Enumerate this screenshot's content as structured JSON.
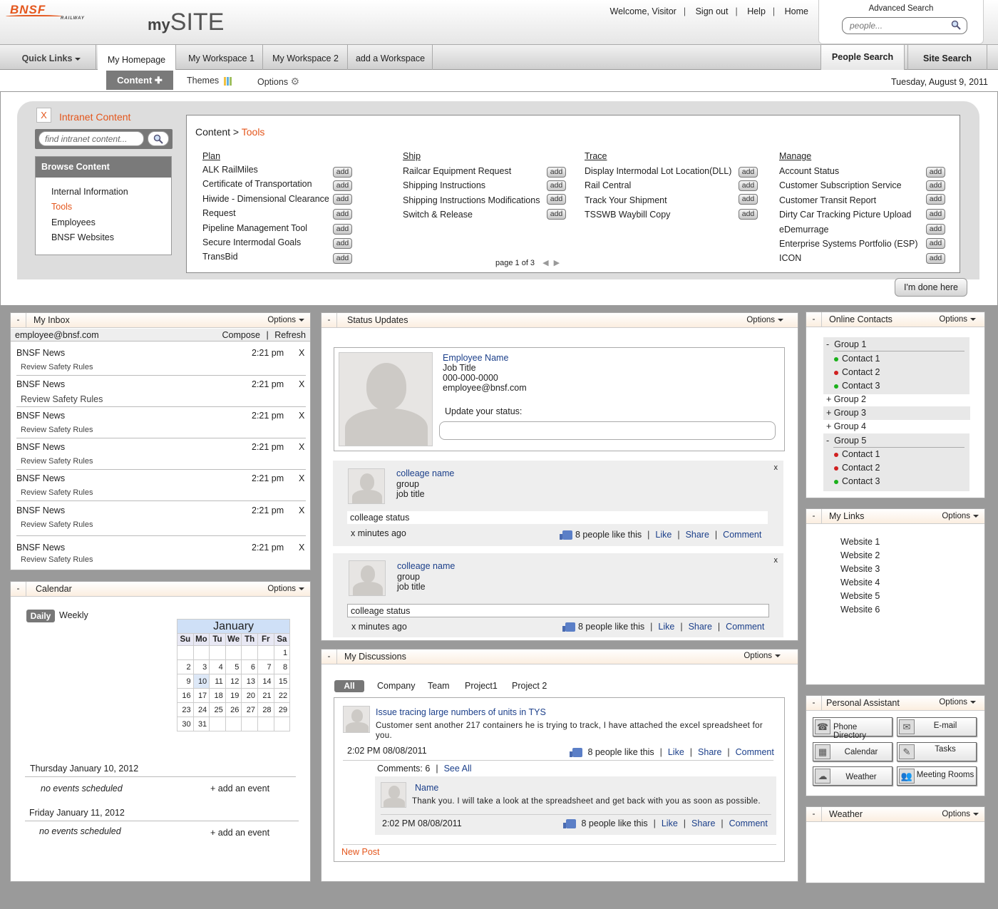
{
  "header": {
    "logo_text": "BNSF",
    "logo_sub": "RAILWAY",
    "site_prefix": "my",
    "site_title": "SITE",
    "links": [
      "Welcome, Visitor",
      "Sign out",
      "Help",
      "Home"
    ],
    "advanced_search": "Advanced Search",
    "people_placeholder": "people..."
  },
  "nav": {
    "quick_links": "Quick Links",
    "tabs": [
      "My Homepage",
      "My Workspace 1",
      "My Workspace 2",
      "add a Workspace"
    ],
    "people_search": "People Search",
    "site_search": "Site Search"
  },
  "subnav": {
    "content": "Content",
    "themes": "Themes",
    "options": "Options",
    "date": "Tuesday, August 9, 2011"
  },
  "intranet": {
    "close": "X",
    "title": "Intranet Content",
    "search_placeholder": "find intranet content...",
    "browse_title": "Browse Content",
    "browse_items": [
      "Internal Information",
      "Tools",
      "Employees",
      "BNSF Websites"
    ],
    "crumb_root": "Content >",
    "crumb_current": "Tools",
    "add_label": "add",
    "page": "page 1 of 3",
    "done": "I'm done here",
    "columns": [
      {
        "title": "Plan",
        "items": [
          "ALK RailMiles",
          "Certificate of Transportation",
          "Hiwide - Dimensional Clearance",
          "Request",
          "Pipeline Management Tool",
          "Secure Intermodal Goals",
          "TransBid"
        ]
      },
      {
        "title": "Ship",
        "items": [
          "Railcar Equipment Request",
          "Shipping Instructions",
          "Shipping Instructions Modifications",
          "Switch & Release"
        ]
      },
      {
        "title": "Trace",
        "items": [
          "Display Intermodal Lot Location(DLL)",
          "Rail Central",
          "Track Your Shipment",
          "TSSWB Waybill Copy"
        ]
      },
      {
        "title": "Manage",
        "items": [
          "Account Status",
          "Customer Subscription Service",
          "Customer Transit Report",
          "Dirty Car Tracking Picture Upload",
          "eDemurrage",
          "Enterprise Systems Portfolio (ESP)",
          "ICON"
        ]
      }
    ]
  },
  "inbox": {
    "title": "My Inbox",
    "options": "Options",
    "email": "employee@bnsf.com",
    "compose": "Compose",
    "refresh": "Refresh",
    "messages": [
      {
        "from": "BNSF News",
        "time": "2:21 pm",
        "subject": "Review Safety Rules"
      },
      {
        "from": "BNSF News",
        "time": "2:21 pm",
        "subject": "Review Safety Rules"
      },
      {
        "from": "BNSF News",
        "time": "2:21 pm",
        "subject": "Review Safety Rules"
      },
      {
        "from": "BNSF News",
        "time": "2:21 pm",
        "subject": "Review Safety Rules"
      },
      {
        "from": "BNSF News",
        "time": "2:21 pm",
        "subject": "Review Safety Rules"
      },
      {
        "from": "BNSF News",
        "time": "2:21 pm",
        "subject": "Review Safety Rules"
      },
      {
        "from": "BNSF News",
        "time": "2:21 pm",
        "subject": "Review Safety Rules"
      }
    ]
  },
  "calendar": {
    "title": "Calendar",
    "options": "Options",
    "daily": "Daily",
    "weekly": "Weekly",
    "month": "January",
    "weekdays": [
      "Su",
      "Mo",
      "Tu",
      "We",
      "Th",
      "Fr",
      "Sa"
    ],
    "days": [
      [
        "",
        "",
        "",
        "",
        "",
        "",
        "1"
      ],
      [
        "2",
        "3",
        "4",
        "5",
        "6",
        "7",
        "8"
      ],
      [
        "9",
        "10",
        "11",
        "12",
        "13",
        "14",
        "15"
      ],
      [
        "16",
        "17",
        "18",
        "19",
        "20",
        "21",
        "22"
      ],
      [
        "23",
        "24",
        "25",
        "26",
        "27",
        "28",
        "29"
      ],
      [
        "30",
        "31",
        "",
        "",
        "",
        "",
        ""
      ]
    ],
    "events": [
      {
        "date": "Thursday January 10, 2012",
        "text": "no events scheduled",
        "add": "+ add an event"
      },
      {
        "date": "Friday January 11, 2012",
        "text": "no events scheduled",
        "add": "+ add an event"
      }
    ]
  },
  "status": {
    "title": "Status Updates",
    "options": "Options",
    "employee_name": "Employee Name",
    "job_title": "Job Title",
    "phone": "000-000-0000",
    "email": "employee@bnsf.com",
    "update_label": "Update your status:",
    "updates": [
      {
        "name": "colleage name",
        "group": "group",
        "job": "job title",
        "status": "colleage status",
        "time": "x minutes ago",
        "likes": "8 people like this",
        "like": "Like",
        "share": "Share",
        "comment": "Comment",
        "close": "x"
      },
      {
        "name": "colleage name",
        "group": "group",
        "job": "job title",
        "status": "colleage status",
        "time": "x minutes ago",
        "likes": "8 people like this",
        "like": "Like",
        "share": "Share",
        "comment": "Comment",
        "close": "x"
      }
    ]
  },
  "discussions": {
    "title": "My Discussions",
    "options": "Options",
    "tabs": [
      "All",
      "Company",
      "Team",
      "Project1",
      "Project 2"
    ],
    "post": {
      "title": "Issue tracing large numbers of units in TYS",
      "body": "Customer sent another 217 containers he is trying to track, I have attached the excel spreadsheet for you.",
      "time": "2:02 PM  08/08/2011",
      "likes": "8 people like this",
      "like": "Like",
      "share": "Share",
      "comment": "Comment",
      "comments_count": "Comments: 6",
      "see_all": "See All"
    },
    "reply": {
      "name": "Name",
      "body": "Thank you.  I will take a look at the spreadsheet and get back with you as soon as possible.",
      "time": "2:02 PM  08/08/2011",
      "likes": "8 people like this",
      "like": "Like",
      "share": "Share",
      "comment": "Comment"
    },
    "new_post": "New Post"
  },
  "contacts": {
    "title": "Online Contacts",
    "options": "Options",
    "groups": [
      {
        "name": "Group 1",
        "toggle": "-",
        "contacts": [
          {
            "name": "Contact 1",
            "status": "online"
          },
          {
            "name": "Contact 2",
            "status": "offline"
          },
          {
            "name": "Contact 3",
            "status": "online"
          }
        ]
      },
      {
        "name": "Group 2",
        "toggle": "+"
      },
      {
        "name": "Group 3",
        "toggle": "+"
      },
      {
        "name": "Group 4",
        "toggle": "+"
      },
      {
        "name": "Group 5",
        "toggle": "-",
        "contacts": [
          {
            "name": "Contact 1",
            "status": "offline"
          },
          {
            "name": "Contact 2",
            "status": "offline"
          },
          {
            "name": "Contact 3",
            "status": "online"
          }
        ]
      }
    ]
  },
  "links": {
    "title": "My Links",
    "options": "Options",
    "items": [
      "Website 1",
      "Website 2",
      "Website 3",
      "Website 4",
      "Website 5",
      "Website 6"
    ]
  },
  "assistant": {
    "title": "Personal Assistant",
    "options": "Options",
    "buttons": [
      "Phone Directory",
      "E-mail",
      "Calendar",
      "Tasks",
      "Weather",
      "Meeting Rooms"
    ]
  },
  "weather": {
    "title": "Weather",
    "options": "Options"
  },
  "colors": {
    "accent": "#e4561c",
    "link": "#1b3f8a",
    "panel_header": "#fbeee0",
    "background": "#9a9a9a"
  }
}
